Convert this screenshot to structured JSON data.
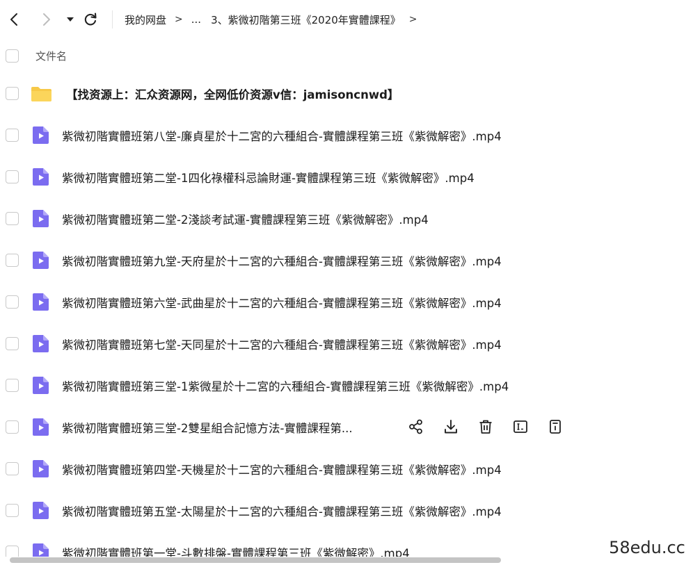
{
  "breadcrumb": {
    "root": "我的网盘",
    "ellipsis": "...",
    "current": "3、紫微初階第三班《2020年實體課程》",
    "separator": ">"
  },
  "list_header": {
    "column_name": "文件名"
  },
  "files": [
    {
      "name": "【找资源上：汇众资源网，全网低价资源v信：jamisoncnwd】",
      "type": "folder"
    },
    {
      "name": "紫微初階實體班第八堂-廉貞星於十二宮的六種組合-實體課程第三班《紫微解密》.mp4",
      "type": "video"
    },
    {
      "name": "紫微初階實體班第二堂-1四化祿權科忌論財運-實體課程第三班《紫微解密》.mp4",
      "type": "video"
    },
    {
      "name": "紫微初階實體班第二堂-2淺談考試運-實體課程第三班《紫微解密》.mp4",
      "type": "video"
    },
    {
      "name": "紫微初階實體班第九堂-天府星於十二宮的六種組合-實體課程第三班《紫微解密》.mp4",
      "type": "video"
    },
    {
      "name": "紫微初階實體班第六堂-武曲星於十二宮的六種組合-實體課程第三班《紫微解密》.mp4",
      "type": "video"
    },
    {
      "name": "紫微初階實體班第七堂-天同星於十二宮的六種組合-實體課程第三班《紫微解密》.mp4",
      "type": "video"
    },
    {
      "name": "紫微初階實體班第三堂-1紫微星於十二宮的六種組合-實體課程第三班《紫微解密》.mp4",
      "type": "video"
    },
    {
      "name": "紫微初階實體班第三堂-2雙星組合記憶方法-實體課程第...",
      "type": "video",
      "hovered": true
    },
    {
      "name": "紫微初階實體班第四堂-天機星於十二宮的六種組合-實體課程第三班《紫微解密》.mp4",
      "type": "video"
    },
    {
      "name": "紫微初階實體班第五堂-太陽星於十二宮的六種組合-實體課程第三班《紫微解密》.mp4",
      "type": "video"
    },
    {
      "name": "紫微初階實體班第一堂-斗數排盤-實體課程第三班《紫微解密》.mp4",
      "type": "video"
    }
  ],
  "row_actions": [
    "share-icon",
    "download-icon",
    "delete-icon",
    "rename-icon",
    "more-icon"
  ],
  "watermark": "58edu.cc",
  "colors": {
    "video_icon": "#7b6cf0",
    "folder_icon": "#f7c948",
    "checkbox_border": "#c9c9c9"
  }
}
